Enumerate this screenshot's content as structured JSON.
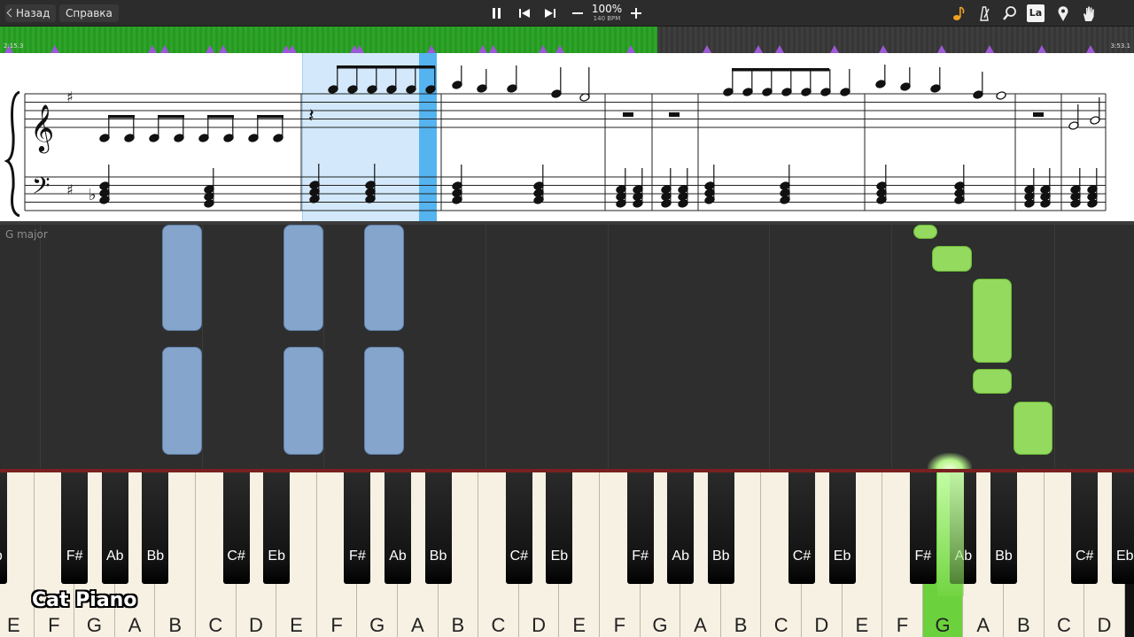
{
  "toolbar": {
    "back_label": "Назад",
    "help_label": "Справка",
    "tempo_percent": "100%",
    "tempo_bpm": "140 BPM",
    "label_icon_text": "La",
    "controls": [
      "pause-icon",
      "previous-icon",
      "next-icon",
      "minus-icon",
      "plus-icon"
    ],
    "right_icons": [
      "note-icon",
      "metronome-icon",
      "magnifier-icon",
      "label-icon",
      "marker-icon",
      "hand-icon"
    ]
  },
  "progress": {
    "elapsed": "2:15.3",
    "total": "3:53.1",
    "fraction": 0.58,
    "fill_color": "#2fa32a",
    "marker_color": "#9b59d6"
  },
  "roll": {
    "key_signature": "G major",
    "note_colors": {
      "left_hand": "#86a5cc",
      "right_hand": "#93da5e"
    }
  },
  "keyboard": {
    "white_keys": [
      "E",
      "F",
      "G",
      "A",
      "B",
      "C",
      "D",
      "E",
      "F",
      "G",
      "A",
      "B",
      "C",
      "D",
      "E",
      "F",
      "G",
      "A",
      "B",
      "C",
      "D",
      "E",
      "F",
      "G",
      "A",
      "B",
      "C",
      "D"
    ],
    "black_keys": [
      "Eb",
      "F#",
      "Ab",
      "Bb",
      "C#",
      "Eb",
      "F#",
      "Ab",
      "Bb",
      "C#",
      "Eb",
      "F#",
      "Ab",
      "Bb",
      "C#",
      "Eb",
      "F#",
      "Ab",
      "Bb",
      "C#",
      "Eb"
    ],
    "active_key": "G",
    "active_color": "#6bd13d"
  },
  "watermark": "Cat Piano"
}
